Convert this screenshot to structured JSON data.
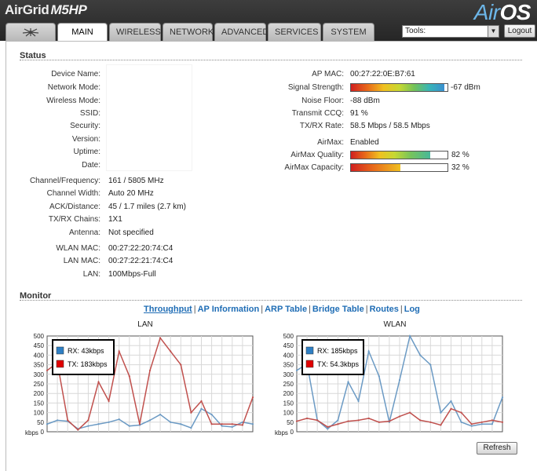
{
  "header": {
    "brand": "AirGrid",
    "model": "M5HP",
    "logo_air": "Air",
    "logo_os": "OS",
    "tabs": [
      {
        "label": "MAIN",
        "active": true
      },
      {
        "label": "WIRELESS",
        "active": false
      },
      {
        "label": "NETWORK",
        "active": false
      },
      {
        "label": "ADVANCED",
        "active": false
      },
      {
        "label": "SERVICES",
        "active": false
      },
      {
        "label": "SYSTEM",
        "active": false
      }
    ],
    "tools_label": "Tools:",
    "logout_label": "Logout"
  },
  "status": {
    "title": "Status",
    "left": [
      {
        "label": "Device Name:",
        "value": ""
      },
      {
        "label": "Network Mode:",
        "value": ""
      },
      {
        "label": "Wireless Mode:",
        "value": ""
      },
      {
        "label": "SSID:",
        "value": ""
      },
      {
        "label": "Security:",
        "value": ""
      },
      {
        "label": "Version:",
        "value": ""
      },
      {
        "label": "Uptime:",
        "value": ""
      },
      {
        "label": "Date:",
        "value": ""
      },
      {
        "label": "Channel/Frequency:",
        "value": "161 / 5805 MHz"
      },
      {
        "label": "Channel Width:",
        "value": "Auto 20 MHz"
      },
      {
        "label": "ACK/Distance:",
        "value": "45 / 1.7 miles (2.7 km)"
      },
      {
        "label": "TX/RX Chains:",
        "value": "1X1"
      },
      {
        "label": "Antenna:",
        "value": "Not specified"
      },
      {
        "label": "WLAN MAC:",
        "value": "00:27:22:20:74:C4"
      },
      {
        "label": "LAN MAC:",
        "value": "00:27:22:21:74:C4"
      },
      {
        "label": "LAN:",
        "value": "100Mbps-Full"
      }
    ],
    "right": {
      "ap_mac_label": "AP MAC:",
      "ap_mac": "00:27:22:0E:B7:61",
      "signal_label": "Signal Strength:",
      "signal_value": "-67 dBm",
      "signal_fraction": 0.97,
      "noise_label": "Noise Floor:",
      "noise_value": "-88 dBm",
      "ccq_label": "Transmit CCQ:",
      "ccq_value": "91 %",
      "rate_label": "TX/RX Rate:",
      "rate_value": "58.5 Mbps / 58.5 Mbps",
      "airmax_label": "AirMax:",
      "airmax_value": "Enabled",
      "quality_label": "AirMax Quality:",
      "quality_value": "82 %",
      "quality_fraction": 0.82,
      "capacity_label": "AirMax Capacity:",
      "capacity_value": "32 %",
      "capacity_fraction": 0.51
    }
  },
  "monitor": {
    "title": "Monitor",
    "links": [
      {
        "label": "Throughput",
        "active": true
      },
      {
        "label": "AP Information",
        "active": false
      },
      {
        "label": "ARP Table",
        "active": false
      },
      {
        "label": "Bridge Table",
        "active": false
      },
      {
        "label": "Routes",
        "active": false
      },
      {
        "label": "Log",
        "active": false
      }
    ],
    "refresh_label": "Refresh"
  },
  "colors": {
    "rx": "#6b9ac4",
    "tx": "#c0504d",
    "rx_legend": "#2e7fc4",
    "tx_legend": "#e00000"
  },
  "chart_data": [
    {
      "type": "line",
      "title": "LAN",
      "ylabel": "kbps",
      "ylim": [
        0,
        500
      ],
      "yticks": [
        0,
        50,
        100,
        150,
        200,
        250,
        300,
        350,
        400,
        450,
        500
      ],
      "x": [
        0,
        1,
        2,
        3,
        4,
        5,
        6,
        7,
        8,
        9,
        10,
        11,
        12,
        13,
        14,
        15,
        16,
        17,
        18,
        19,
        20
      ],
      "series": [
        {
          "name": "RX: 43kbps",
          "values": [
            40,
            60,
            55,
            15,
            30,
            40,
            50,
            65,
            30,
            35,
            60,
            90,
            50,
            40,
            20,
            120,
            90,
            30,
            25,
            50,
            40
          ]
        },
        {
          "name": "TX: 183kbps",
          "values": [
            320,
            360,
            60,
            10,
            60,
            260,
            160,
            420,
            290,
            40,
            320,
            490,
            420,
            350,
            100,
            160,
            40,
            40,
            40,
            35,
            180
          ]
        }
      ]
    },
    {
      "type": "line",
      "title": "WLAN",
      "ylabel": "kbps",
      "ylim": [
        0,
        500
      ],
      "yticks": [
        0,
        50,
        100,
        150,
        200,
        250,
        300,
        350,
        400,
        450,
        500
      ],
      "x": [
        0,
        1,
        2,
        3,
        4,
        5,
        6,
        7,
        8,
        9,
        10,
        11,
        12,
        13,
        14,
        15,
        16,
        17,
        18,
        19,
        20
      ],
      "series": [
        {
          "name": "RX: 185kbps",
          "values": [
            320,
            355,
            60,
            15,
            60,
            260,
            160,
            420,
            290,
            50,
            270,
            500,
            400,
            350,
            100,
            160,
            50,
            30,
            40,
            40,
            180
          ]
        },
        {
          "name": "TX: 54.3kbps",
          "values": [
            55,
            70,
            60,
            25,
            40,
            55,
            60,
            70,
            50,
            55,
            80,
            100,
            60,
            50,
            35,
            120,
            100,
            40,
            50,
            60,
            50
          ]
        }
      ]
    }
  ]
}
